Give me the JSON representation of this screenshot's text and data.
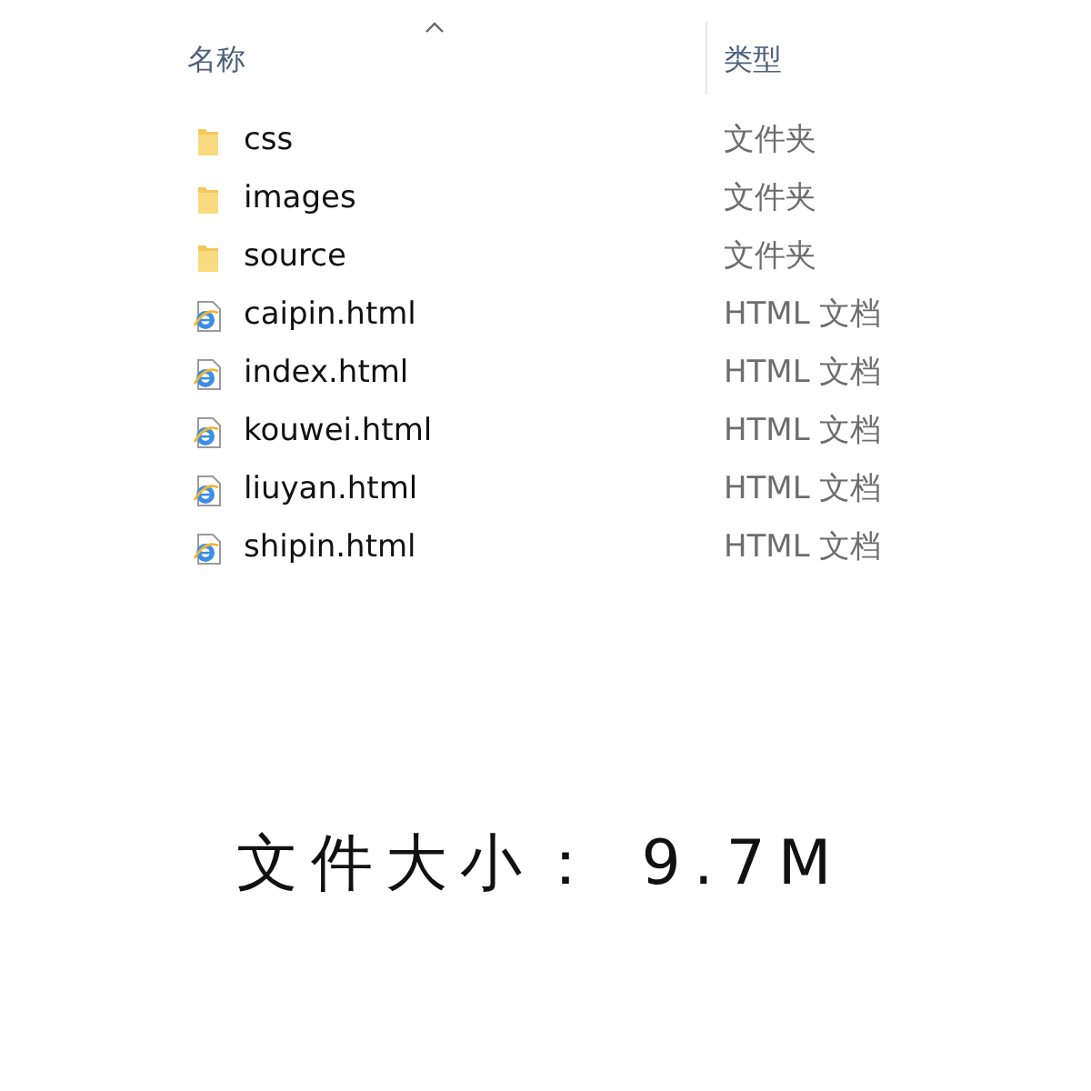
{
  "columns": [
    {
      "label": "名称",
      "sorted": true
    },
    {
      "label": "类型",
      "sorted": false
    }
  ],
  "files": [
    {
      "name": "css",
      "type": "文件夹",
      "kind": "folder"
    },
    {
      "name": "images",
      "type": "文件夹",
      "kind": "folder"
    },
    {
      "name": "source",
      "type": "文件夹",
      "kind": "folder"
    },
    {
      "name": "caipin.html",
      "type": "HTML 文档",
      "kind": "html"
    },
    {
      "name": "index.html",
      "type": "HTML 文档",
      "kind": "html"
    },
    {
      "name": "kouwei.html",
      "type": "HTML 文档",
      "kind": "html"
    },
    {
      "name": "liuyan.html",
      "type": "HTML 文档",
      "kind": "html"
    },
    {
      "name": "shipin.html",
      "type": "HTML 文档",
      "kind": "html"
    }
  ],
  "caption": "文件大小： 9.7M"
}
